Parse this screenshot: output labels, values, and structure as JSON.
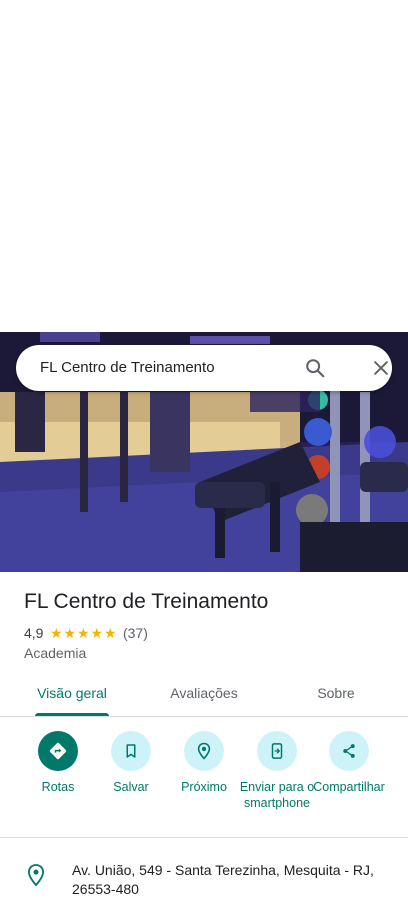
{
  "search": {
    "query": "FL Centro de Treinamento"
  },
  "place": {
    "name": "FL Centro de Treinamento",
    "rating": "4,9",
    "stars": 5,
    "reviews": "(37)",
    "category": "Academia"
  },
  "tabs": [
    {
      "label": "Visão geral",
      "active": true
    },
    {
      "label": "Avaliações",
      "active": false
    },
    {
      "label": "Sobre",
      "active": false
    }
  ],
  "actions": [
    {
      "label": "Rotas",
      "icon": "directions-icon"
    },
    {
      "label": "Salvar",
      "icon": "bookmark-icon"
    },
    {
      "label": "Próximo",
      "icon": "nearby-icon"
    },
    {
      "label": "Enviar para o smartphone",
      "icon": "send-to-phone-icon"
    },
    {
      "label": "Compartilhar",
      "icon": "share-icon"
    }
  ],
  "address": {
    "text": "Av. União, 549 - Santa Terezinha, Mesquita - RJ, 26553-480"
  },
  "colors": {
    "accent": "#00796b",
    "chip_bg": "#cdf3f8",
    "star": "#f4b400"
  }
}
